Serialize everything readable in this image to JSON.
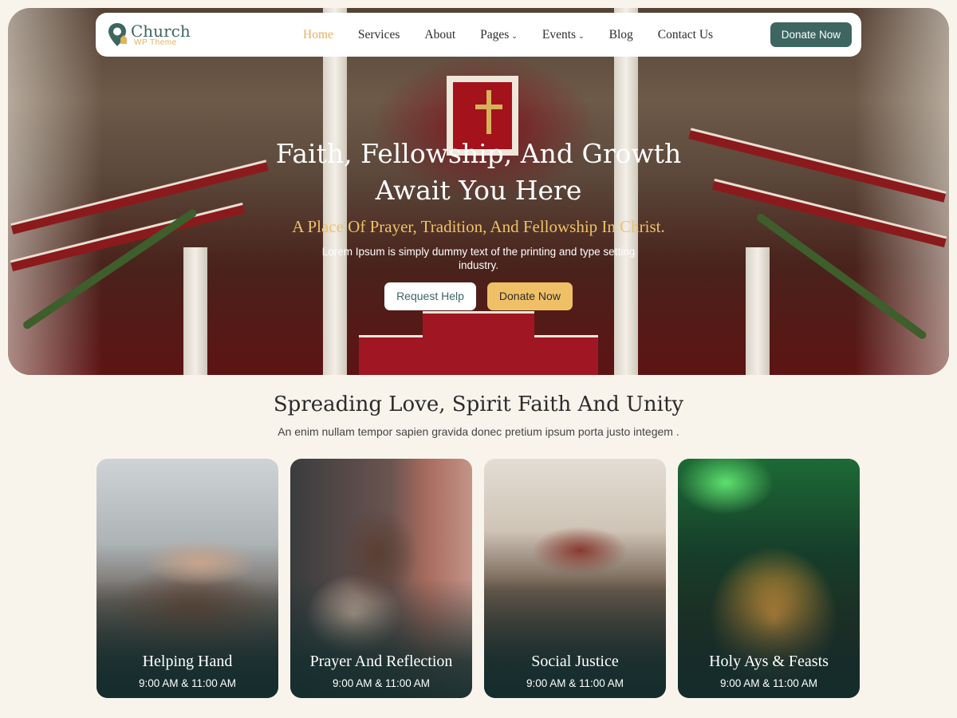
{
  "brand": {
    "name": "Church",
    "tagline": "WP Theme",
    "primary_color": "#3d6661",
    "accent_color": "#efc066"
  },
  "nav": {
    "items": [
      {
        "label": "Home",
        "active": true,
        "dropdown": false
      },
      {
        "label": "Services",
        "active": false,
        "dropdown": false
      },
      {
        "label": "About",
        "active": false,
        "dropdown": false
      },
      {
        "label": "Pages",
        "active": false,
        "dropdown": true
      },
      {
        "label": "Events",
        "active": false,
        "dropdown": true
      },
      {
        "label": "Blog",
        "active": false,
        "dropdown": false
      },
      {
        "label": "Contact Us",
        "active": false,
        "dropdown": false
      }
    ],
    "donate_label": "Donate Now"
  },
  "hero": {
    "title_line1": "Faith, Fellowship, And Growth",
    "title_line2": "Await You Here",
    "subtitle": "A Place Of Prayer, Tradition, And Fellowship In Christ.",
    "description": "Lorem Ipsum is simply dummy text of the printing and type setting industry.",
    "help_label": "Request Help",
    "donate_label": "Donate Now"
  },
  "section": {
    "title": "Spreading Love, Spirit Faith And Unity",
    "description": "An enim nullam tempor sapien gravida donec pretium ipsum porta justo integem ."
  },
  "cards": [
    {
      "title": "Helping Hand",
      "time": "9:00 AM & 11:00 AM"
    },
    {
      "title": "Prayer And Reflection",
      "time": "9:00 AM & 11:00 AM"
    },
    {
      "title": "Social Justice",
      "time": "9:00 AM & 11:00 AM"
    },
    {
      "title": "Holy Ays & Feasts",
      "time": "9:00 AM & 11:00 AM"
    }
  ]
}
